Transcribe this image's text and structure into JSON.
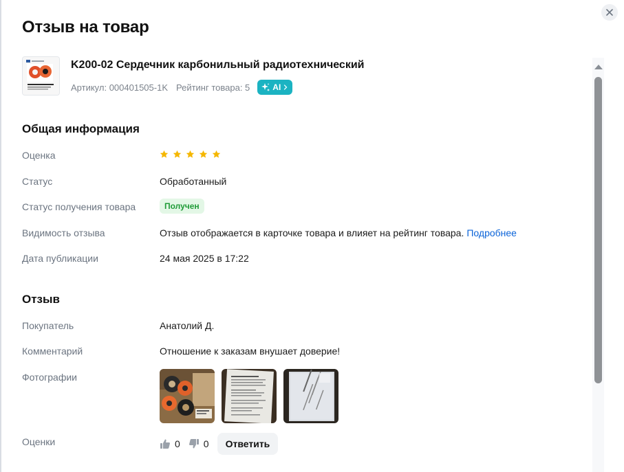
{
  "modal": {
    "title": "Отзыв на товар"
  },
  "product": {
    "name": "K200-02 Сердечник карбонильный радиотехнический",
    "article": "Артикул: 000401505-1K",
    "rating": "Рейтинг товара: 5",
    "ai_label": "AI"
  },
  "general": {
    "title": "Общая информация",
    "rating_label": "Оценка",
    "stars_filled": 5,
    "stars_total": 5,
    "status_label": "Статус",
    "status_value": "Обработанный",
    "receipt_label": "Статус получения товара",
    "receipt_value": "Получен",
    "visibility_label": "Видимость отзыва",
    "visibility_value": "Отзыв отображается в карточке товара и влияет на рейтинг товара.",
    "visibility_link": "Подробнее",
    "date_label": "Дата публикации",
    "date_value": "24 мая 2025 в 17:22"
  },
  "review": {
    "title": "Отзыв",
    "buyer_label": "Покупатель",
    "buyer_value": "Анатолий Д.",
    "comment_label": "Комментарий",
    "comment_value": "Отношение к заказам внушает доверие!",
    "photos_label": "Фотографии",
    "photos_count": 3,
    "votes_label": "Оценки",
    "likes": "0",
    "dislikes": "0",
    "reply_label": "Ответить"
  },
  "colors": {
    "star": "#f5b700",
    "ai_badge": "#1bb3c2",
    "status_green": "#1f9b37",
    "link": "#0a63d8"
  },
  "icons": [
    "close-icon",
    "sparkle-icon",
    "chevron-right-icon",
    "star-icon",
    "thumbs-up-icon",
    "thumbs-down-icon",
    "scroll-up-arrow-icon"
  ]
}
